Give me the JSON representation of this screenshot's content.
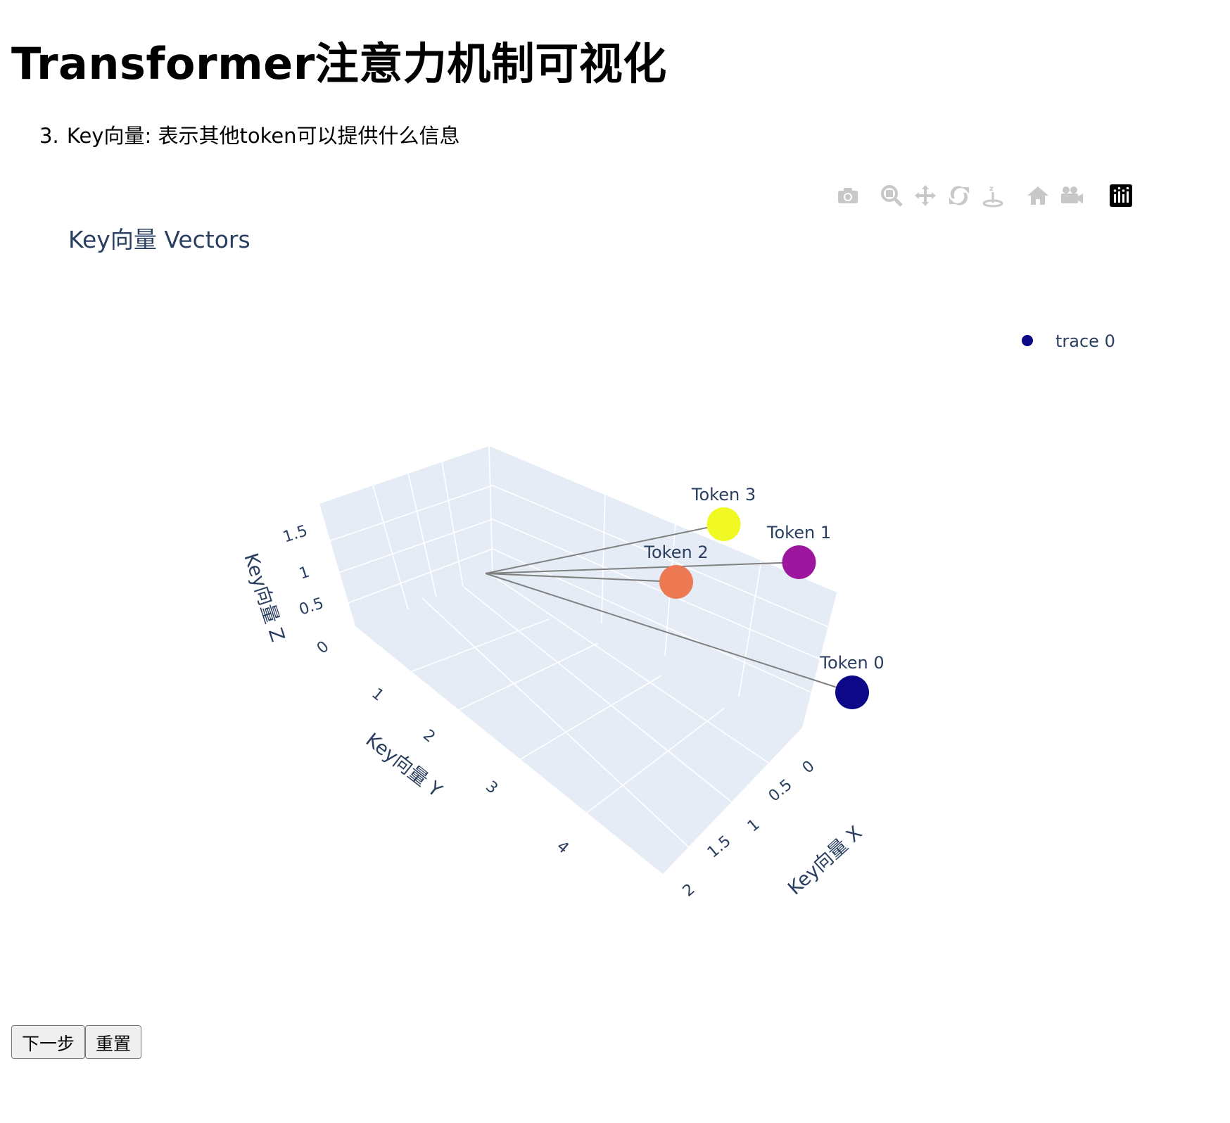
{
  "page": {
    "title": "Transformer注意力机制可视化",
    "step_number": "3.",
    "step_text": "Key向量: 表示其他token可以提供什么信息"
  },
  "toolbar": {
    "items": [
      {
        "name": "camera-icon",
        "label": "Download plot as a png"
      },
      {
        "name": "zoom-icon",
        "label": "Zoom"
      },
      {
        "name": "pan-icon",
        "label": "Pan"
      },
      {
        "name": "orbit-rotation-icon",
        "label": "Orbital rotation"
      },
      {
        "name": "turntable-rotation-icon",
        "label": "Turntable rotation"
      },
      {
        "name": "home-icon",
        "label": "Reset camera to default"
      },
      {
        "name": "camera-last-save-icon",
        "label": "Reset camera to last save"
      },
      {
        "name": "plotly-logo-icon",
        "label": "Produced with Plotly"
      }
    ]
  },
  "chart_data": {
    "type": "scatter3d",
    "title": "Key向量 Vectors",
    "xlabel": "Key向量 X",
    "ylabel": "Key向量 Y",
    "zlabel": "Key向量 Z",
    "xlim": [
      0,
      2
    ],
    "ylim": [
      0,
      5
    ],
    "zlim": [
      0,
      1.8
    ],
    "x_ticks": [
      "0",
      "0.5",
      "1",
      "1.5",
      "2"
    ],
    "y_ticks": [
      "1",
      "2",
      "3",
      "4"
    ],
    "z_ticks": [
      "0",
      "0.5",
      "1",
      "1.5"
    ],
    "grid": true,
    "legend": {
      "position": "top-right",
      "entries": [
        {
          "name": "trace 0",
          "color": "#0d0887"
        }
      ]
    },
    "line_color": "#808080",
    "points": [
      {
        "label": "Token 0",
        "x": 0.6,
        "y": 4.1,
        "z": 0.9,
        "color": "#0d0887"
      },
      {
        "label": "Token 1",
        "x": 1.3,
        "y": 1.7,
        "z": 0.2,
        "color": "#9c179e"
      },
      {
        "label": "Token 2",
        "x": 0.2,
        "y": 2.6,
        "z": 1.6,
        "color": "#ed7953"
      },
      {
        "label": "Token 3",
        "x": 0.7,
        "y": 2.2,
        "z": 1.6,
        "color": "#f0f921"
      }
    ],
    "origin": {
      "x": 0,
      "y": 0,
      "z": 0
    }
  },
  "buttons": {
    "next_label": "下一步",
    "reset_label": "重置"
  },
  "colors": {
    "scene_bg": "#e5ecf6",
    "grid": "#ffffff",
    "axis_text": "#2a3f5f",
    "toolbar_icon": "#c8c8c8"
  }
}
